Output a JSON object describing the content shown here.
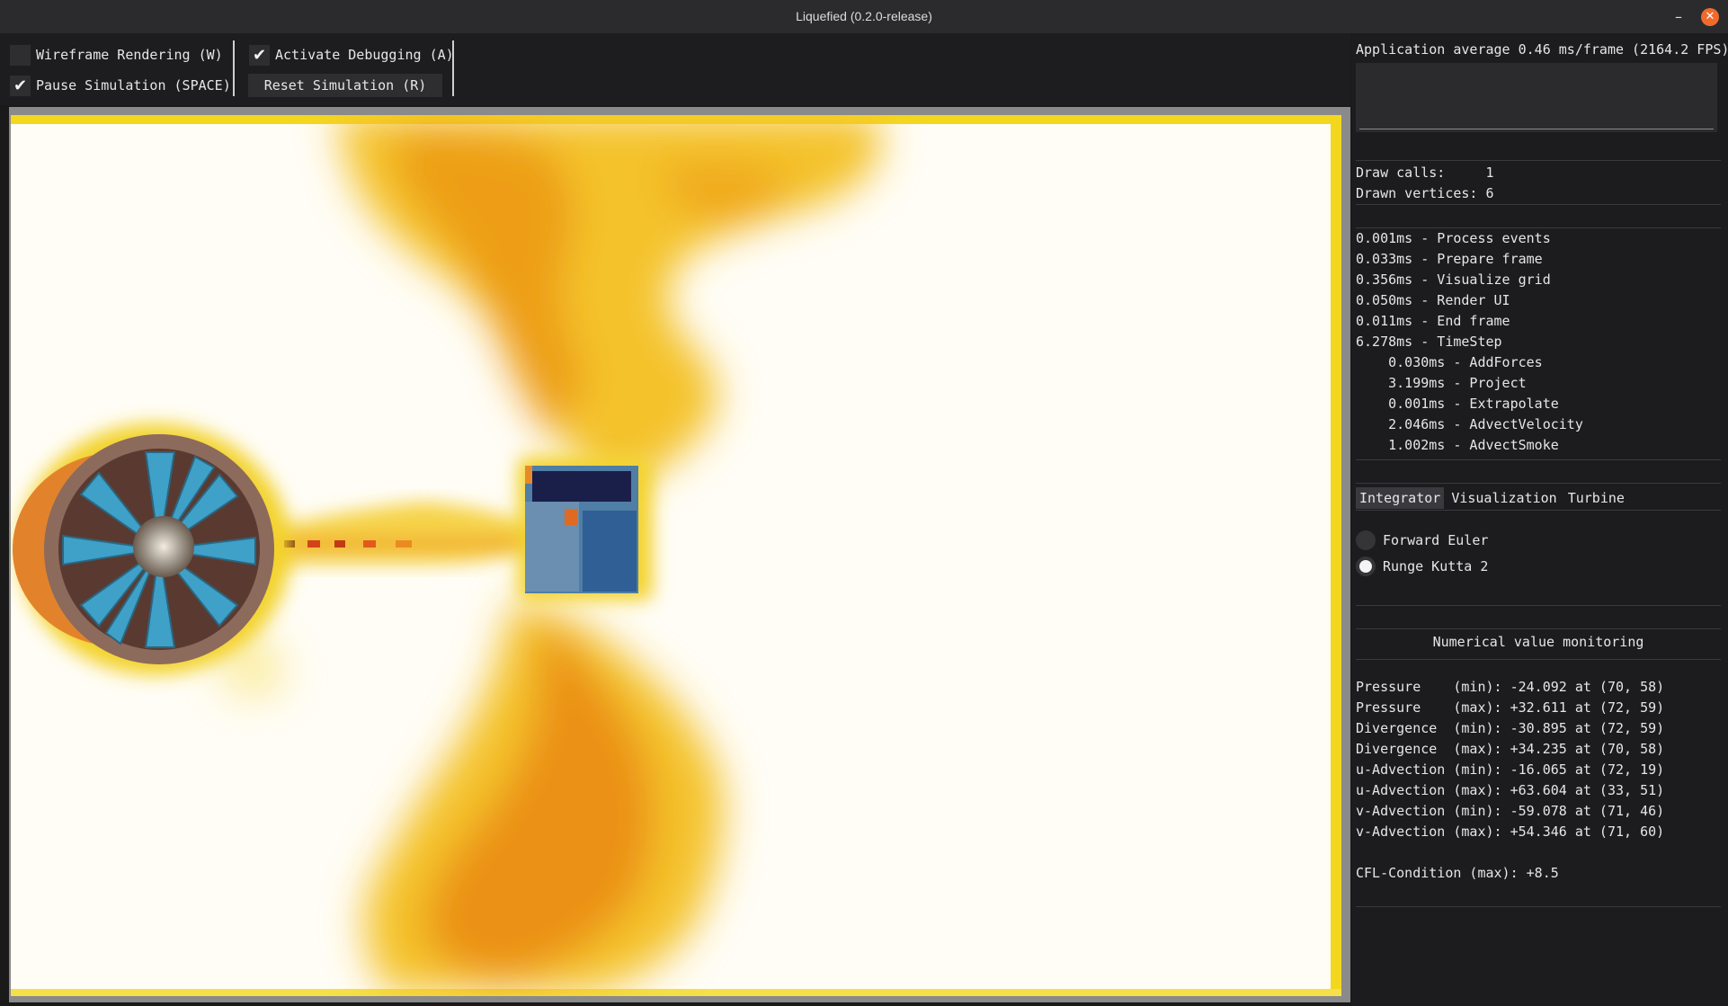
{
  "window": {
    "title": "Liquefied (0.2.0-release)",
    "minimize": "–",
    "close": "✕"
  },
  "toolbar": {
    "wireframe": {
      "label": "Wireframe Rendering  (W)",
      "checked": false
    },
    "pause": {
      "label": "Pause Simulation (SPACE)",
      "checked": true
    },
    "debug": {
      "label": "Activate Debugging (A)",
      "checked": true
    },
    "reset_label": "Reset Simulation (R)"
  },
  "stats": {
    "avg": "Application average 0.46 ms/frame (2164.2 FPS)",
    "draw_calls": "Draw calls:     1",
    "drawn_vertices": "Drawn vertices: 6"
  },
  "timings": [
    "0.001ms - Process events",
    "0.033ms - Prepare frame",
    "0.356ms - Visualize grid",
    "0.050ms - Render UI",
    "0.011ms - End frame",
    "6.278ms - TimeStep",
    "    0.030ms - AddForces",
    "    3.199ms - Project",
    "    0.001ms - Extrapolate",
    "    2.046ms - AdvectVelocity",
    "    1.002ms - AdvectSmoke"
  ],
  "tabs": [
    "Integrator",
    "Visualization",
    "Turbine"
  ],
  "integrator": {
    "forward_euler": "Forward Euler",
    "runge_kutta": "Runge Kutta 2"
  },
  "monitoring": {
    "title": "Numerical value monitoring",
    "lines": [
      "Pressure    (min): -24.092 at (70, 58)",
      "Pressure    (max): +32.611 at (72, 59)",
      "Divergence  (min): -30.895 at (72, 59)",
      "Divergence  (max): +34.235 at (70, 58)",
      "u-Advection (min): -16.065 at (72, 19)",
      "u-Advection (max): +63.604 at (33, 51)",
      "v-Advection (min): -59.078 at (71, 46)",
      "v-Advection (max): +54.346 at (71, 60)"
    ],
    "cfl": "CFL-Condition (max): +8.5"
  },
  "colors": {
    "smoke_dark": "#e8890f",
    "smoke_light": "#f5d21c",
    "turbine_blue": "#3fa0c8",
    "close_button": "#f06a2d"
  }
}
